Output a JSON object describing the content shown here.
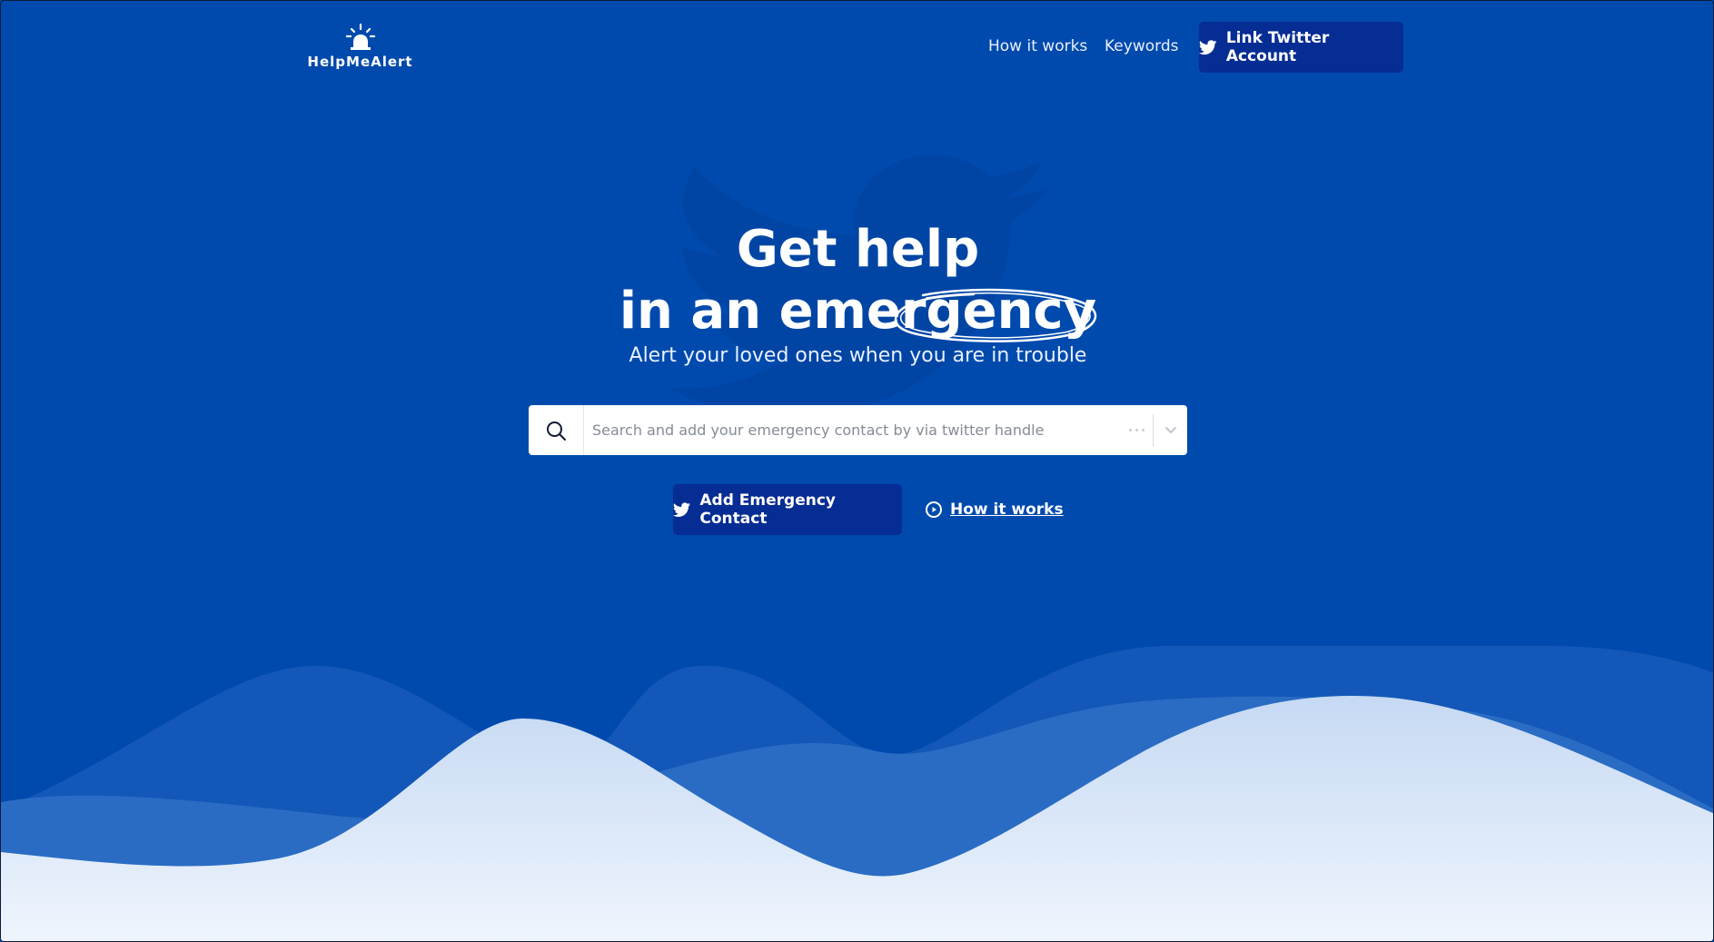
{
  "app": {
    "name": "HelpMeAlert",
    "logo_icon": "siren-alert-icon"
  },
  "nav": {
    "how_it_works": "How it works",
    "keywords": "Keywords",
    "link_twitter": "Link Twitter Account"
  },
  "hero": {
    "title_line1": "Get help",
    "title_line2": "in an emergency",
    "subtitle": "Alert your loved ones when you are in trouble"
  },
  "search": {
    "placeholder": "Search and add your emergency contact by via twitter handle",
    "value": ""
  },
  "actions": {
    "add_contact": "Add Emergency Contact",
    "how_it_works": "How it works"
  },
  "colors": {
    "background": "#004aad",
    "button": "#062d93",
    "white": "#ffffff"
  }
}
